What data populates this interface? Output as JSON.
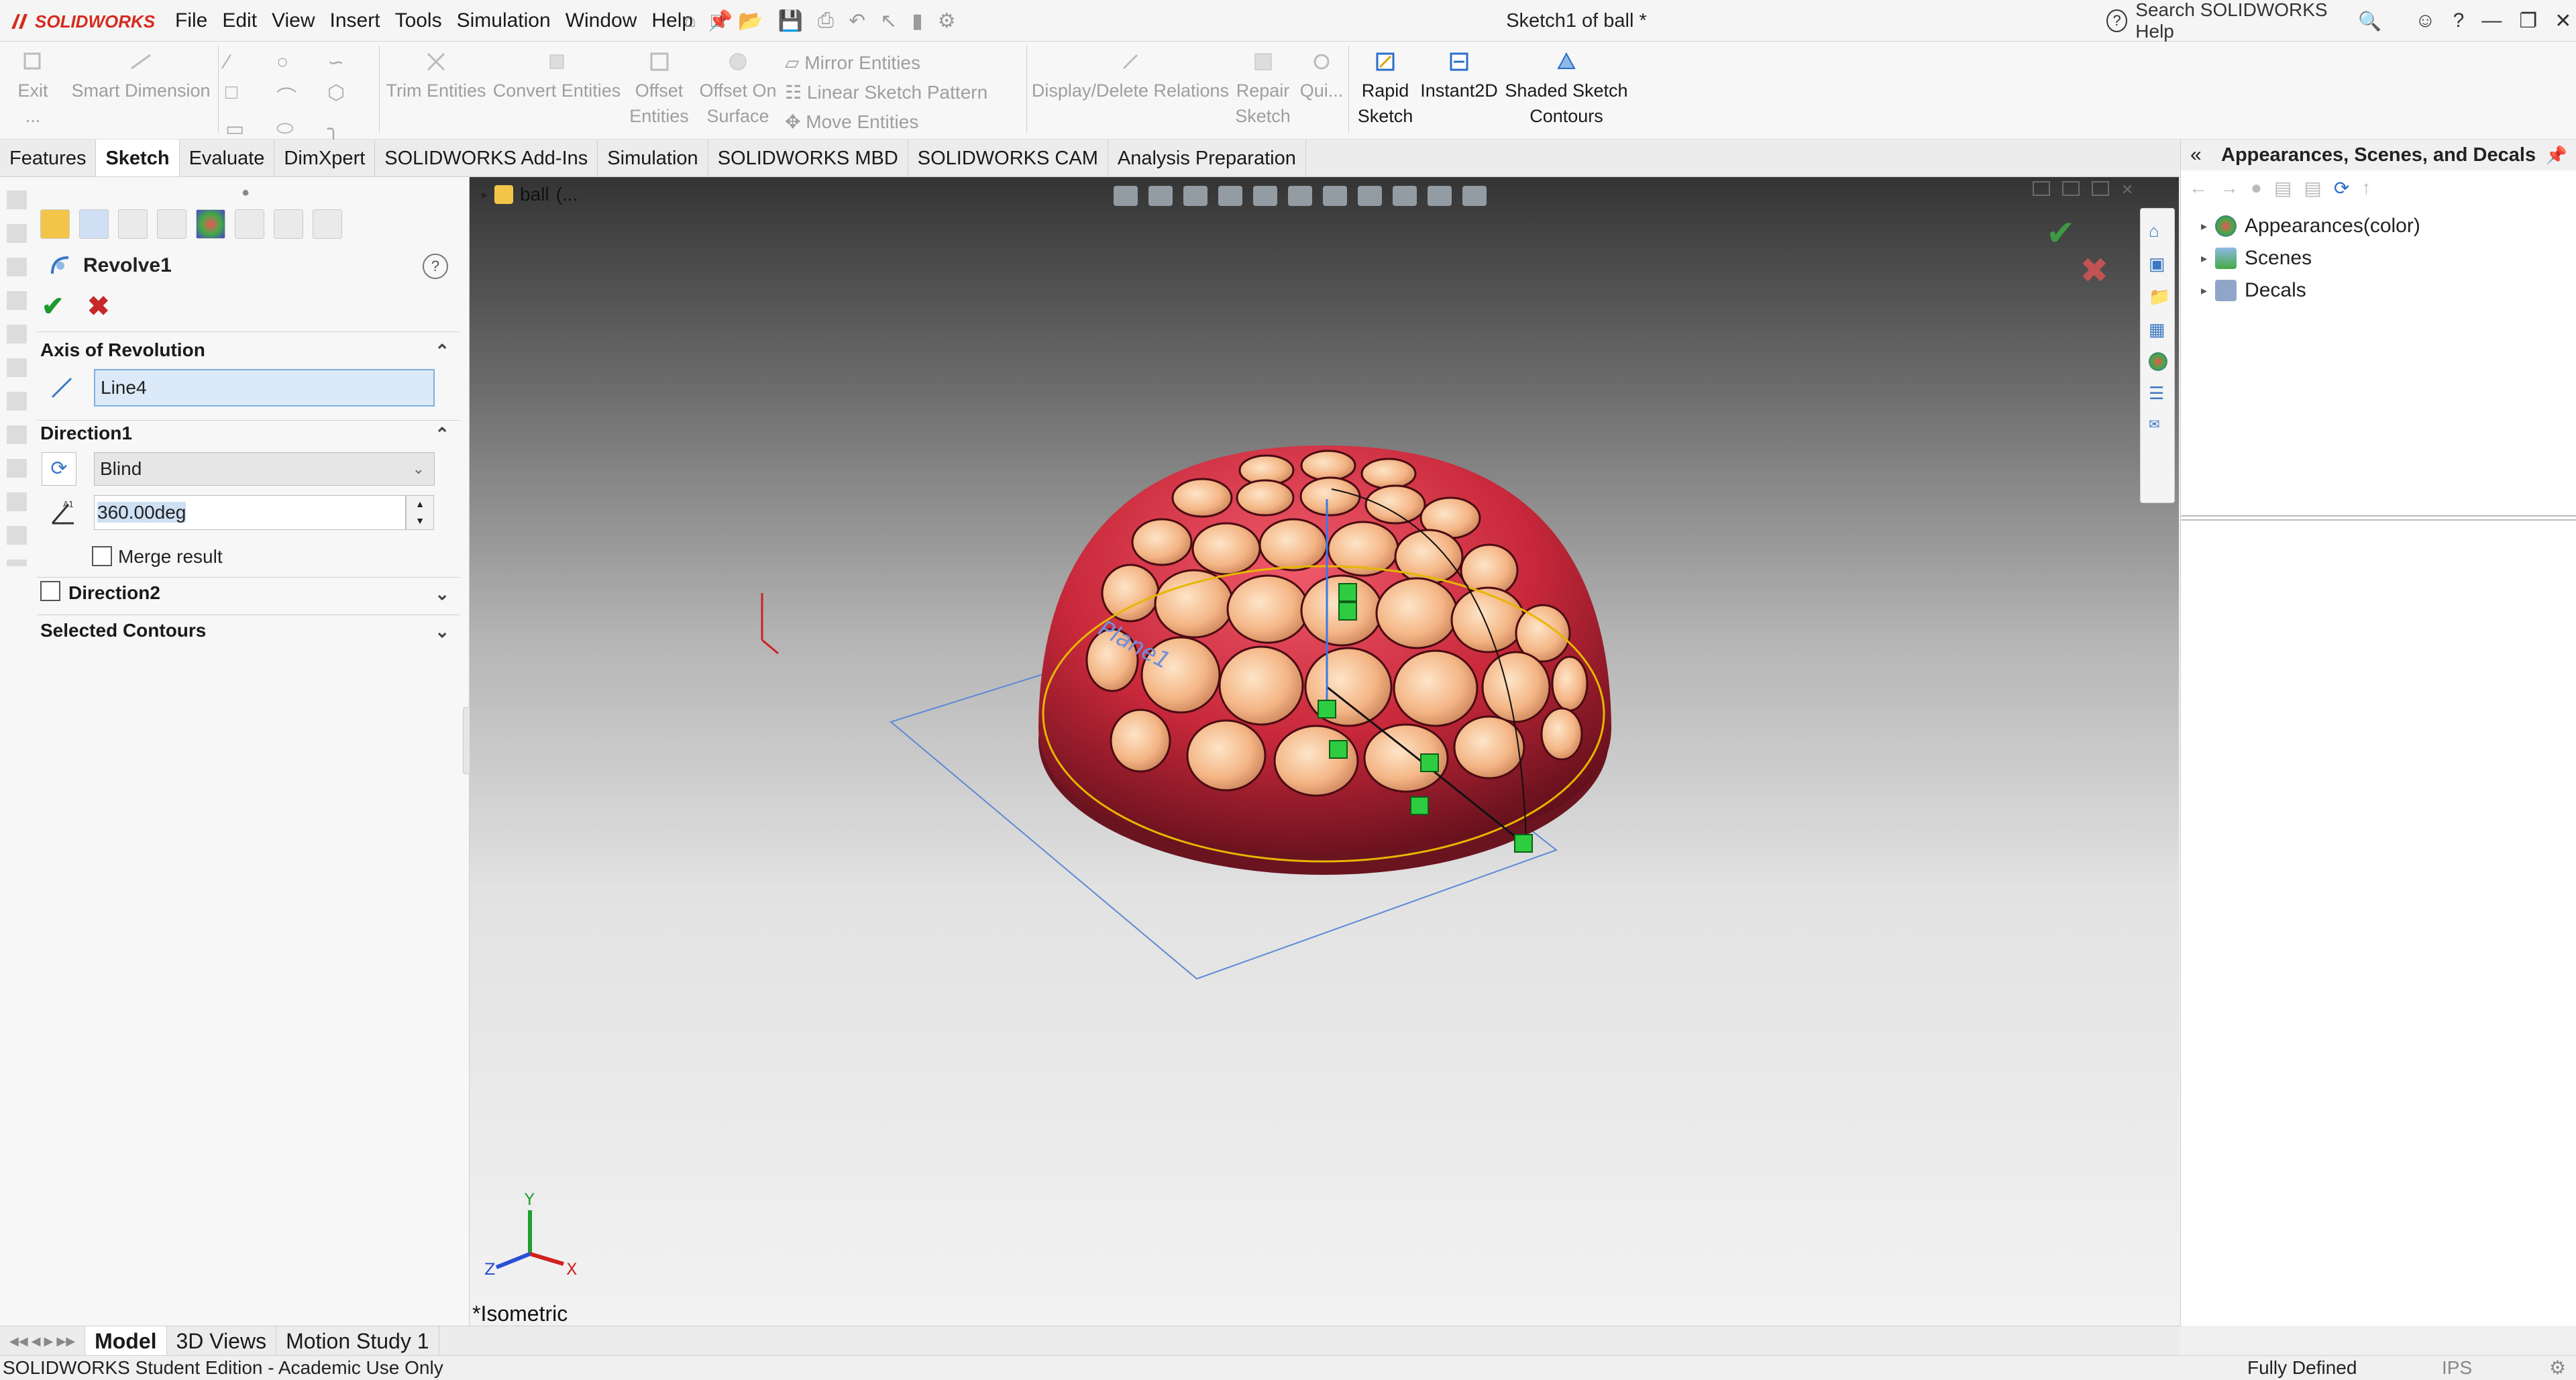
{
  "app": {
    "brand": "SOLIDWORKS",
    "document_title": "Sketch1 of ball *"
  },
  "menu": [
    "File",
    "Edit",
    "View",
    "Insert",
    "Tools",
    "Simulation",
    "Window",
    "Help"
  ],
  "search": {
    "placeholder": "Search SOLIDWORKS Help"
  },
  "commands": {
    "exit": "Exit ...",
    "smart_dimension": "Smart Dimension",
    "trim_entities": "Trim Entities",
    "convert_entities": "Convert Entities",
    "offset_entities": "Offset Entities",
    "offset_on_surface": "Offset On Surface",
    "mirror_entities": "Mirror Entities",
    "linear_sketch_pattern": "Linear Sketch Pattern",
    "move_entities": "Move Entities",
    "display_delete_relations": "Display/Delete Relations",
    "repair_sketch": "Repair Sketch",
    "quick_snaps": "Qui...",
    "rapid_sketch": "Rapid Sketch",
    "instant2d": "Instant2D",
    "shaded_sketch_contours": "Shaded Sketch Contours"
  },
  "tabs": [
    "Features",
    "Sketch",
    "Evaluate",
    "DimXpert",
    "SOLIDWORKS Add-Ins",
    "Simulation",
    "SOLIDWORKS MBD",
    "SOLIDWORKS CAM",
    "Analysis Preparation"
  ],
  "property_manager": {
    "title": "Revolve1",
    "axis_section": "Axis of Revolution",
    "axis_value": "Line4",
    "direction1_section": "Direction1",
    "direction1_type": "Blind",
    "angle": "360.00deg",
    "merge_result": "Merge result",
    "direction2_section": "Direction2",
    "selected_contours_section": "Selected Contours"
  },
  "viewport": {
    "feature_tree_root": "ball",
    "feature_tree_suffix": "(...",
    "view_name": "*Isometric",
    "plane_label": "Plane1",
    "triad": {
      "x": "X",
      "y": "Y",
      "z": "Z"
    },
    "colors": {
      "body": "#c8283a",
      "hole": "#f4b585",
      "sketch": "#1a6fd6",
      "contour": "#e6b700"
    }
  },
  "task_pane": {
    "title": "Appearances, Scenes, and Decals",
    "items": [
      "Appearances(color)",
      "Scenes",
      "Decals"
    ]
  },
  "bottom_tabs": [
    "Model",
    "3D Views",
    "Motion Study 1"
  ],
  "status": {
    "left": "SOLIDWORKS Student Edition - Academic Use Only",
    "right": "Fully Defined",
    "units": "IPS"
  }
}
